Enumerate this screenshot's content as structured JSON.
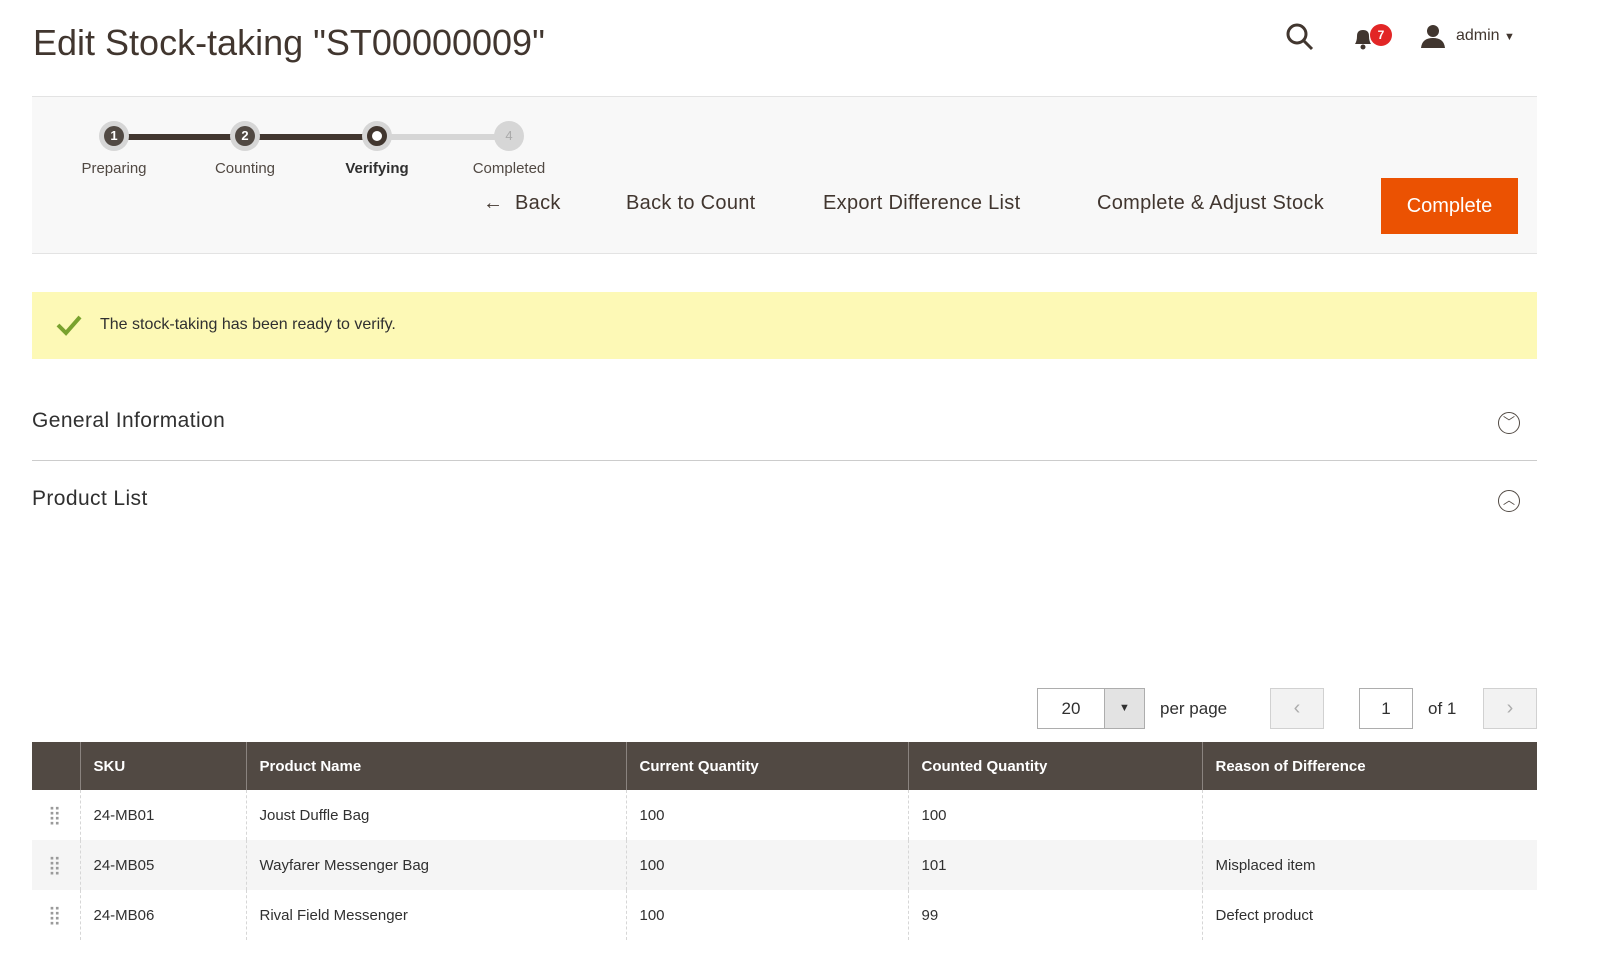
{
  "header": {
    "title": "Edit Stock-taking \"ST00000009\"",
    "notifications": "7",
    "user": "admin",
    "icons": [
      "search-icon",
      "bell-icon",
      "user-icon"
    ]
  },
  "steps": [
    {
      "num": "1",
      "label": "Preparing"
    },
    {
      "num": "2",
      "label": "Counting"
    },
    {
      "num": "",
      "label": "Verifying"
    },
    {
      "num": "4",
      "label": "Completed"
    }
  ],
  "toolbar": {
    "back": "Back",
    "back_to_count": "Back to Count",
    "export": "Export Difference List",
    "complete_adjust": "Complete & Adjust Stock",
    "complete": "Complete"
  },
  "message": "The stock-taking has been ready to verify.",
  "sections": {
    "general": "General Information",
    "products": "Product List"
  },
  "pager": {
    "per_page_value": "20",
    "per_page_label": "per page",
    "page": "1",
    "of": "of 1"
  },
  "table": {
    "columns": [
      "SKU",
      "Product Name",
      "Current Quantity",
      "Counted Quantity",
      "Reason of Difference"
    ],
    "rows": [
      [
        "24-MB01",
        "Joust Duffle Bag",
        "100",
        "100",
        ""
      ],
      [
        "24-MB05",
        "Wayfarer Messenger Bag",
        "100",
        "101",
        "Misplaced item"
      ],
      [
        "24-MB06",
        "Rival Field Messenger",
        "100",
        "99",
        "Defect product"
      ]
    ]
  },
  "colors": {
    "accent": "#eb5202",
    "header_bg": "#514943",
    "message_bg": "#fdf9b6"
  }
}
